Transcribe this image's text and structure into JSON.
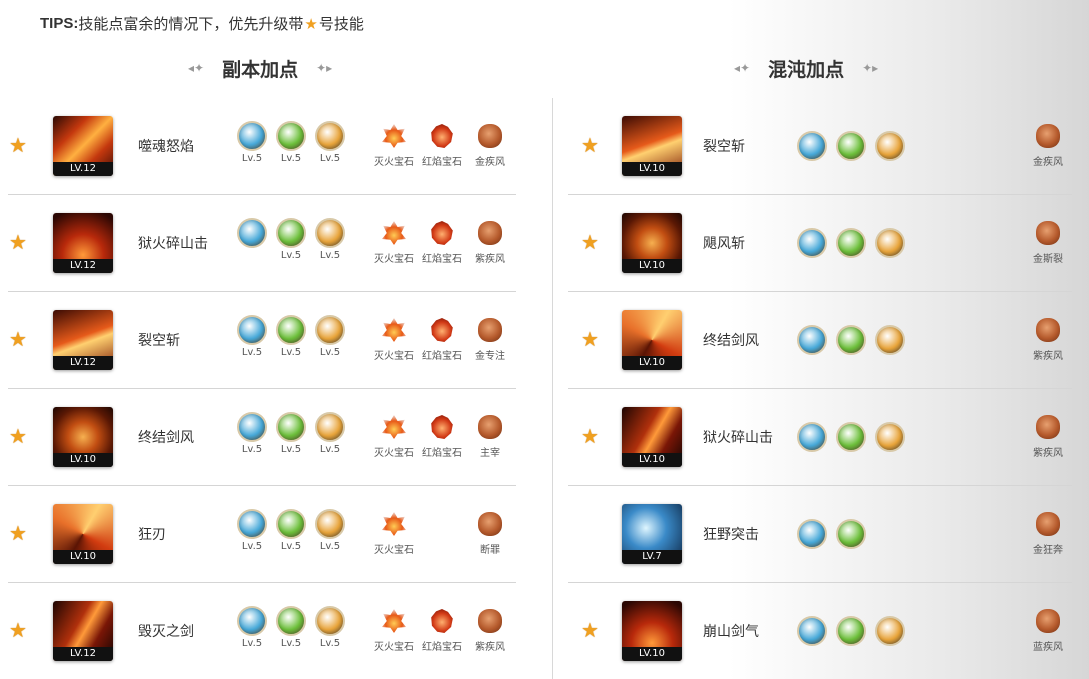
{
  "tips": {
    "prefix": "TIPS:",
    "text_before": "技能点富余的情况下，优先升级带",
    "text_after": "号技能"
  },
  "sections": {
    "left_title": "副本加点",
    "right_title": "混沌加点"
  },
  "left_rows": [
    {
      "starred": true,
      "name": "噬魂怒焰",
      "level": "LV.12",
      "runes": [
        {
          "lv": "Lv.5",
          "color": "#46a8d8"
        },
        {
          "lv": "Lv.5",
          "color": "#6cbf3a"
        },
        {
          "lv": "Lv.5",
          "color": "#e8a43a"
        }
      ],
      "gems": [
        {
          "label": "灭火宝石",
          "type": "fire"
        },
        {
          "label": "红焰宝石",
          "type": "red"
        },
        {
          "label": "金疾风",
          "type": "brown"
        }
      ]
    },
    {
      "starred": true,
      "name": "狱火碎山击",
      "level": "LV.12",
      "runes": [
        {
          "lv": "",
          "color": "#46a8d8"
        },
        {
          "lv": "Lv.5",
          "color": "#6cbf3a"
        },
        {
          "lv": "Lv.5",
          "color": "#e8a43a"
        }
      ],
      "gems": [
        {
          "label": "灭火宝石",
          "type": "fire"
        },
        {
          "label": "红焰宝石",
          "type": "red"
        },
        {
          "label": "紫疾风",
          "type": "brown"
        }
      ]
    },
    {
      "starred": true,
      "name": "裂空斩",
      "level": "LV.12",
      "runes": [
        {
          "lv": "Lv.5",
          "color": "#46a8d8"
        },
        {
          "lv": "Lv.5",
          "color": "#6cbf3a"
        },
        {
          "lv": "Lv.5",
          "color": "#e8a43a"
        }
      ],
      "gems": [
        {
          "label": "灭火宝石",
          "type": "fire"
        },
        {
          "label": "红焰宝石",
          "type": "red"
        },
        {
          "label": "金专注",
          "type": "brown"
        }
      ]
    },
    {
      "starred": true,
      "name": "终结剑风",
      "level": "LV.10",
      "runes": [
        {
          "lv": "Lv.5",
          "color": "#46a8d8"
        },
        {
          "lv": "Lv.5",
          "color": "#6cbf3a"
        },
        {
          "lv": "Lv.5",
          "color": "#e8a43a"
        }
      ],
      "gems": [
        {
          "label": "灭火宝石",
          "type": "fire"
        },
        {
          "label": "红焰宝石",
          "type": "red"
        },
        {
          "label": "主宰",
          "type": "brown"
        }
      ]
    },
    {
      "starred": true,
      "name": "狂刃",
      "level": "LV.10",
      "runes": [
        {
          "lv": "Lv.5",
          "color": "#46a8d8"
        },
        {
          "lv": "Lv.5",
          "color": "#6cbf3a"
        },
        {
          "lv": "Lv.5",
          "color": "#e8a43a"
        }
      ],
      "gems": [
        {
          "label": "灭火宝石",
          "type": "fire"
        },
        {
          "label": "",
          "type": "none"
        },
        {
          "label": "断罪",
          "type": "brown"
        }
      ]
    },
    {
      "starred": true,
      "name": "毁灭之剑",
      "level": "LV.12",
      "runes": [
        {
          "lv": "Lv.5",
          "color": "#46a8d8"
        },
        {
          "lv": "Lv.5",
          "color": "#6cbf3a"
        },
        {
          "lv": "Lv.5",
          "color": "#e8a43a"
        }
      ],
      "gems": [
        {
          "label": "灭火宝石",
          "type": "fire"
        },
        {
          "label": "红焰宝石",
          "type": "red"
        },
        {
          "label": "紫疾风",
          "type": "brown"
        }
      ]
    }
  ],
  "right_rows": [
    {
      "starred": true,
      "name": "裂空斩",
      "level": "LV.10",
      "runes": [
        {
          "color": "#46a8d8"
        },
        {
          "color": "#6cbf3a"
        },
        {
          "color": "#e8a43a"
        }
      ],
      "gem": {
        "label": "金疾风"
      }
    },
    {
      "starred": true,
      "name": "飓风斩",
      "level": "LV.10",
      "runes": [
        {
          "color": "#46a8d8"
        },
        {
          "color": "#6cbf3a"
        },
        {
          "color": "#e8a43a"
        }
      ],
      "gem": {
        "label": "金斯裂"
      }
    },
    {
      "starred": true,
      "name": "终结剑风",
      "level": "LV.10",
      "runes": [
        {
          "color": "#46a8d8"
        },
        {
          "color": "#6cbf3a"
        },
        {
          "color": "#e8a43a"
        }
      ],
      "gem": {
        "label": "紫疾风"
      }
    },
    {
      "starred": true,
      "name": "狱火碎山击",
      "level": "LV.10",
      "runes": [
        {
          "color": "#46a8d8"
        },
        {
          "color": "#6cbf3a"
        },
        {
          "color": "#e8a43a"
        }
      ],
      "gem": {
        "label": "紫疾风"
      }
    },
    {
      "starred": false,
      "name": "狂野突击",
      "level": "LV.7",
      "runes": [
        {
          "color": "#46a8d8"
        },
        {
          "color": "#6cbf3a"
        }
      ],
      "gem": {
        "label": "金狂奔"
      }
    },
    {
      "starred": true,
      "name": "崩山剑气",
      "level": "LV.10",
      "runes": [
        {
          "color": "#46a8d8"
        },
        {
          "color": "#6cbf3a"
        },
        {
          "color": "#e8a43a"
        }
      ],
      "gem": {
        "label": "蓝疾风"
      }
    }
  ],
  "colors": {
    "star": "#f0a020",
    "divider": "#d5d5d5"
  }
}
